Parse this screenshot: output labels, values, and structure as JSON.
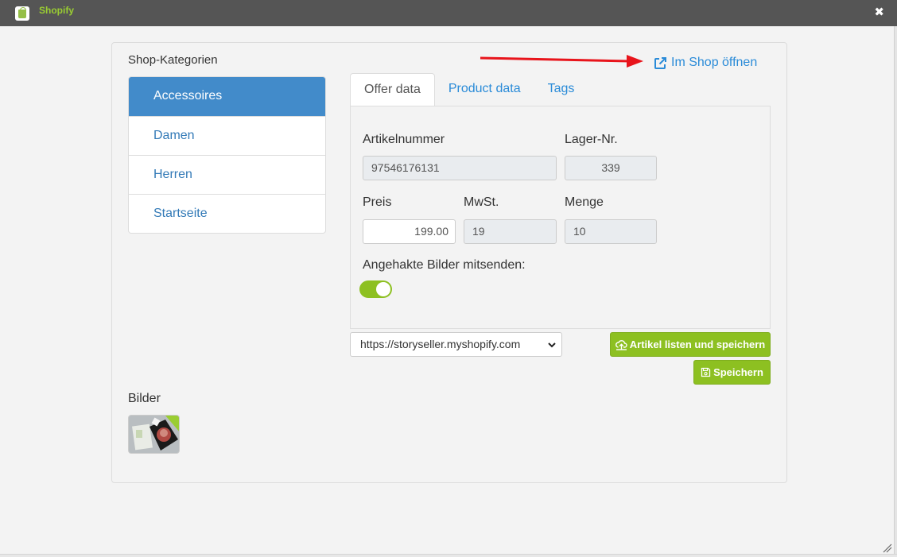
{
  "window": {
    "title": "Shopify",
    "close_symbol": "✖"
  },
  "categories": {
    "title": "Shop-Kategorien",
    "items": [
      {
        "label": "Accessoires",
        "active": true
      },
      {
        "label": "Damen"
      },
      {
        "label": "Herren"
      },
      {
        "label": "Startseite"
      }
    ]
  },
  "shop_link": {
    "label": "Im Shop öffnen"
  },
  "tabs": [
    {
      "label": "Offer data",
      "active": true
    },
    {
      "label": "Product data"
    },
    {
      "label": "Tags"
    }
  ],
  "offer": {
    "article_number_label": "Artikelnummer",
    "article_number": "97546176131",
    "stock_number_label": "Lager-Nr.",
    "stock_number": "339",
    "price_label": "Preis",
    "price": "199.00",
    "vat_label": "MwSt.",
    "vat": "19",
    "quantity_label": "Menge",
    "quantity": "10",
    "send_images_label": "Angehakte Bilder mitsenden:",
    "send_images": true
  },
  "shop_select": {
    "value": "https://storyseller.myshopify.com"
  },
  "buttons": {
    "list_and_save": "Artikel listen und speichern",
    "save": "Speichern"
  },
  "images": {
    "title": "Bilder"
  },
  "colors": {
    "accent_green": "#8dc021",
    "link_blue": "#2a8bd8",
    "active_blue": "#428bca",
    "titlebar": "#555555"
  }
}
